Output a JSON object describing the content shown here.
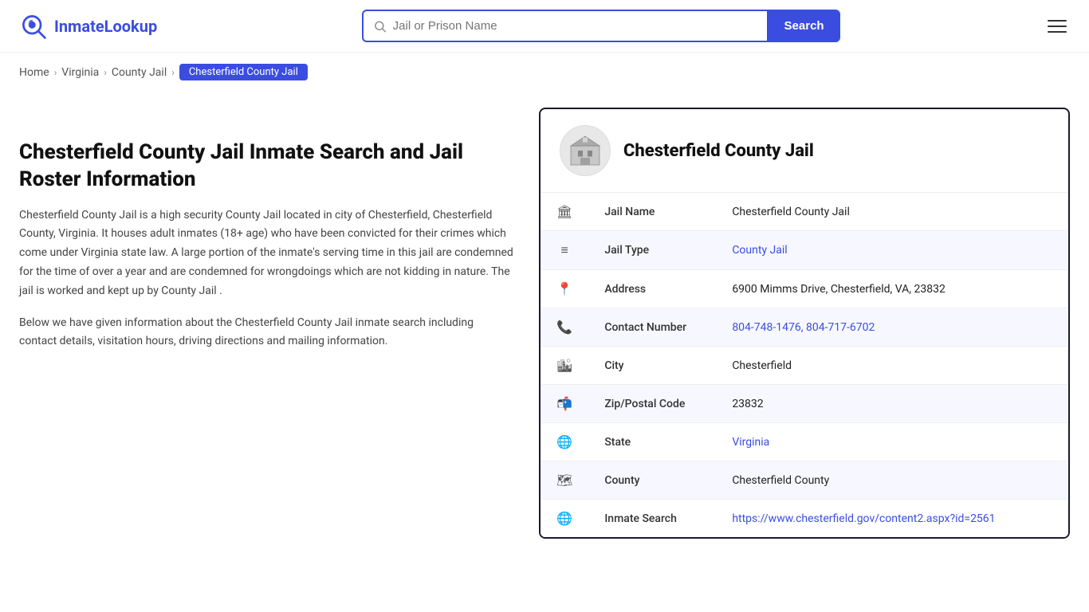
{
  "header": {
    "logo_text_part1": "Inmate",
    "logo_text_part2": "Lookup",
    "search_placeholder": "Jail or Prison Name",
    "search_button_label": "Search"
  },
  "breadcrumb": {
    "home": "Home",
    "virginia": "Virginia",
    "county_jail": "County Jail",
    "current": "Chesterfield County Jail"
  },
  "left": {
    "title": "Chesterfield County Jail Inmate Search and Jail Roster Information",
    "description1": "Chesterfield County Jail is a high security County Jail located in city of Chesterfield, Chesterfield County, Virginia. It houses adult inmates (18+ age) who have been convicted for their crimes which come under Virginia state law. A large portion of the inmate's serving time in this jail are condemned for the time of over a year and are condemned for wrongdoings which are not kidding in nature. The jail is worked and kept up by County Jail .",
    "description2": "Below we have given information about the Chesterfield County Jail inmate search including contact details, visitation hours, driving directions and mailing information."
  },
  "card": {
    "title": "Chesterfield County Jail",
    "fields": [
      {
        "icon": "building",
        "label": "Jail Name",
        "value": "Chesterfield County Jail",
        "link": false
      },
      {
        "icon": "list",
        "label": "Jail Type",
        "value": "County Jail",
        "link": true,
        "href": "#"
      },
      {
        "icon": "pin",
        "label": "Address",
        "value": "6900 Mimms Drive, Chesterfield, VA, 23832",
        "link": false
      },
      {
        "icon": "phone",
        "label": "Contact Number",
        "value": "804-748-1476, 804-717-6702",
        "link": true,
        "href": "tel:8047481476"
      },
      {
        "icon": "city",
        "label": "City",
        "value": "Chesterfield",
        "link": false
      },
      {
        "icon": "mail",
        "label": "Zip/Postal Code",
        "value": "23832",
        "link": false
      },
      {
        "icon": "globe",
        "label": "State",
        "value": "Virginia",
        "link": true,
        "href": "#"
      },
      {
        "icon": "county",
        "label": "County",
        "value": "Chesterfield County",
        "link": false
      },
      {
        "icon": "search-link",
        "label": "Inmate Search",
        "value": "https://www.chesterfield.gov/content2.aspx?id=2561",
        "link": true,
        "href": "https://www.chesterfield.gov/content2.aspx?id=2561"
      }
    ]
  }
}
